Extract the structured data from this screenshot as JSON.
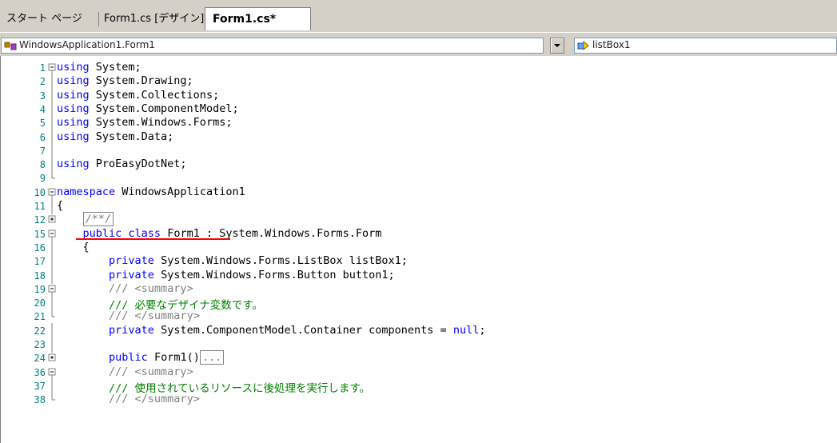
{
  "tabs": [
    {
      "label": "スタート ページ",
      "active": false
    },
    {
      "label": "Form1.cs [デザイン]*",
      "active": false
    },
    {
      "label": "Form1.cs*",
      "active": true
    }
  ],
  "nav": {
    "class_combo": "WindowsApplication1.Form1",
    "member_combo": "listBox1"
  },
  "code_lines": [
    {
      "num": "1",
      "fold": "minus",
      "parts": [
        [
          "kw",
          "using"
        ],
        [
          "t",
          " System;"
        ]
      ]
    },
    {
      "num": "2",
      "fold": "bar",
      "parts": [
        [
          "kw",
          "using"
        ],
        [
          "t",
          " System.Drawing;"
        ]
      ]
    },
    {
      "num": "3",
      "fold": "bar",
      "parts": [
        [
          "kw",
          "using"
        ],
        [
          "t",
          " System.Collections;"
        ]
      ]
    },
    {
      "num": "4",
      "fold": "bar",
      "parts": [
        [
          "kw",
          "using"
        ],
        [
          "t",
          " System.ComponentModel;"
        ]
      ]
    },
    {
      "num": "5",
      "fold": "bar",
      "parts": [
        [
          "kw",
          "using"
        ],
        [
          "t",
          " System.Windows.Forms;"
        ]
      ]
    },
    {
      "num": "6",
      "fold": "bar",
      "parts": [
        [
          "kw",
          "using"
        ],
        [
          "t",
          " System.Data;"
        ]
      ]
    },
    {
      "num": "7",
      "fold": "bar",
      "parts": []
    },
    {
      "num": "8",
      "fold": "bar",
      "parts": [
        [
          "kw",
          "using"
        ],
        [
          "t",
          " ProEasyDotNet;"
        ]
      ]
    },
    {
      "num": "9",
      "fold": "end",
      "parts": []
    },
    {
      "num": "10",
      "fold": "minus",
      "parts": [
        [
          "kw",
          "namespace"
        ],
        [
          "t",
          " WindowsApplication1"
        ]
      ]
    },
    {
      "num": "11",
      "fold": "bar",
      "parts": [
        [
          "t",
          "{"
        ]
      ]
    },
    {
      "num": "12",
      "fold": "plus",
      "parts": [
        [
          "t",
          "    "
        ],
        [
          "box",
          "/**/"
        ]
      ]
    },
    {
      "num": "15",
      "fold": "minus",
      "parts": [
        [
          "t",
          "    "
        ],
        [
          "kw",
          "public class"
        ],
        [
          "t",
          " Form1 : System.Windows.Forms.Form"
        ]
      ]
    },
    {
      "num": "16",
      "fold": "bar",
      "parts": [
        [
          "t",
          "    {"
        ]
      ]
    },
    {
      "num": "17",
      "fold": "bar",
      "parts": [
        [
          "t",
          "        "
        ],
        [
          "kw",
          "private"
        ],
        [
          "t",
          " System.Windows.Forms.ListBox listBox1;"
        ]
      ]
    },
    {
      "num": "18",
      "fold": "bar",
      "parts": [
        [
          "t",
          "        "
        ],
        [
          "kw",
          "private"
        ],
        [
          "t",
          " System.Windows.Forms.Button button1;"
        ]
      ]
    },
    {
      "num": "19",
      "fold": "minus",
      "parts": [
        [
          "t",
          "        "
        ],
        [
          "cmg",
          "/// <summary>"
        ]
      ]
    },
    {
      "num": "20",
      "fold": "bar",
      "parts": [
        [
          "t",
          "        "
        ],
        [
          "cm",
          "/// 必要なデザイナ変数です。"
        ]
      ]
    },
    {
      "num": "21",
      "fold": "end",
      "parts": [
        [
          "t",
          "        "
        ],
        [
          "cmg",
          "/// </summary>"
        ]
      ]
    },
    {
      "num": "22",
      "fold": "bar",
      "parts": [
        [
          "t",
          "        "
        ],
        [
          "kw",
          "private"
        ],
        [
          "t",
          " System.ComponentModel.Container components = "
        ],
        [
          "kw",
          "null"
        ],
        [
          "t",
          ";"
        ]
      ]
    },
    {
      "num": "23",
      "fold": "bar",
      "parts": []
    },
    {
      "num": "24",
      "fold": "plus",
      "parts": [
        [
          "t",
          "        "
        ],
        [
          "kw",
          "public"
        ],
        [
          "t",
          " Form1()"
        ],
        [
          "box",
          "..."
        ]
      ]
    },
    {
      "num": "36",
      "fold": "minus",
      "parts": [
        [
          "t",
          "        "
        ],
        [
          "cmg",
          "/// <summary>"
        ]
      ]
    },
    {
      "num": "37",
      "fold": "bar",
      "parts": [
        [
          "t",
          "        "
        ],
        [
          "cm",
          "/// 使用されているリソースに後処理を実行します。"
        ]
      ]
    },
    {
      "num": "38",
      "fold": "end",
      "parts": [
        [
          "t",
          "        "
        ],
        [
          "cmg",
          "/// </summary>"
        ]
      ]
    }
  ],
  "colors": {
    "keyword": "#0000ff",
    "comment": "#008000",
    "line_number": "#008080",
    "highlight_underline": "#ff0000"
  }
}
